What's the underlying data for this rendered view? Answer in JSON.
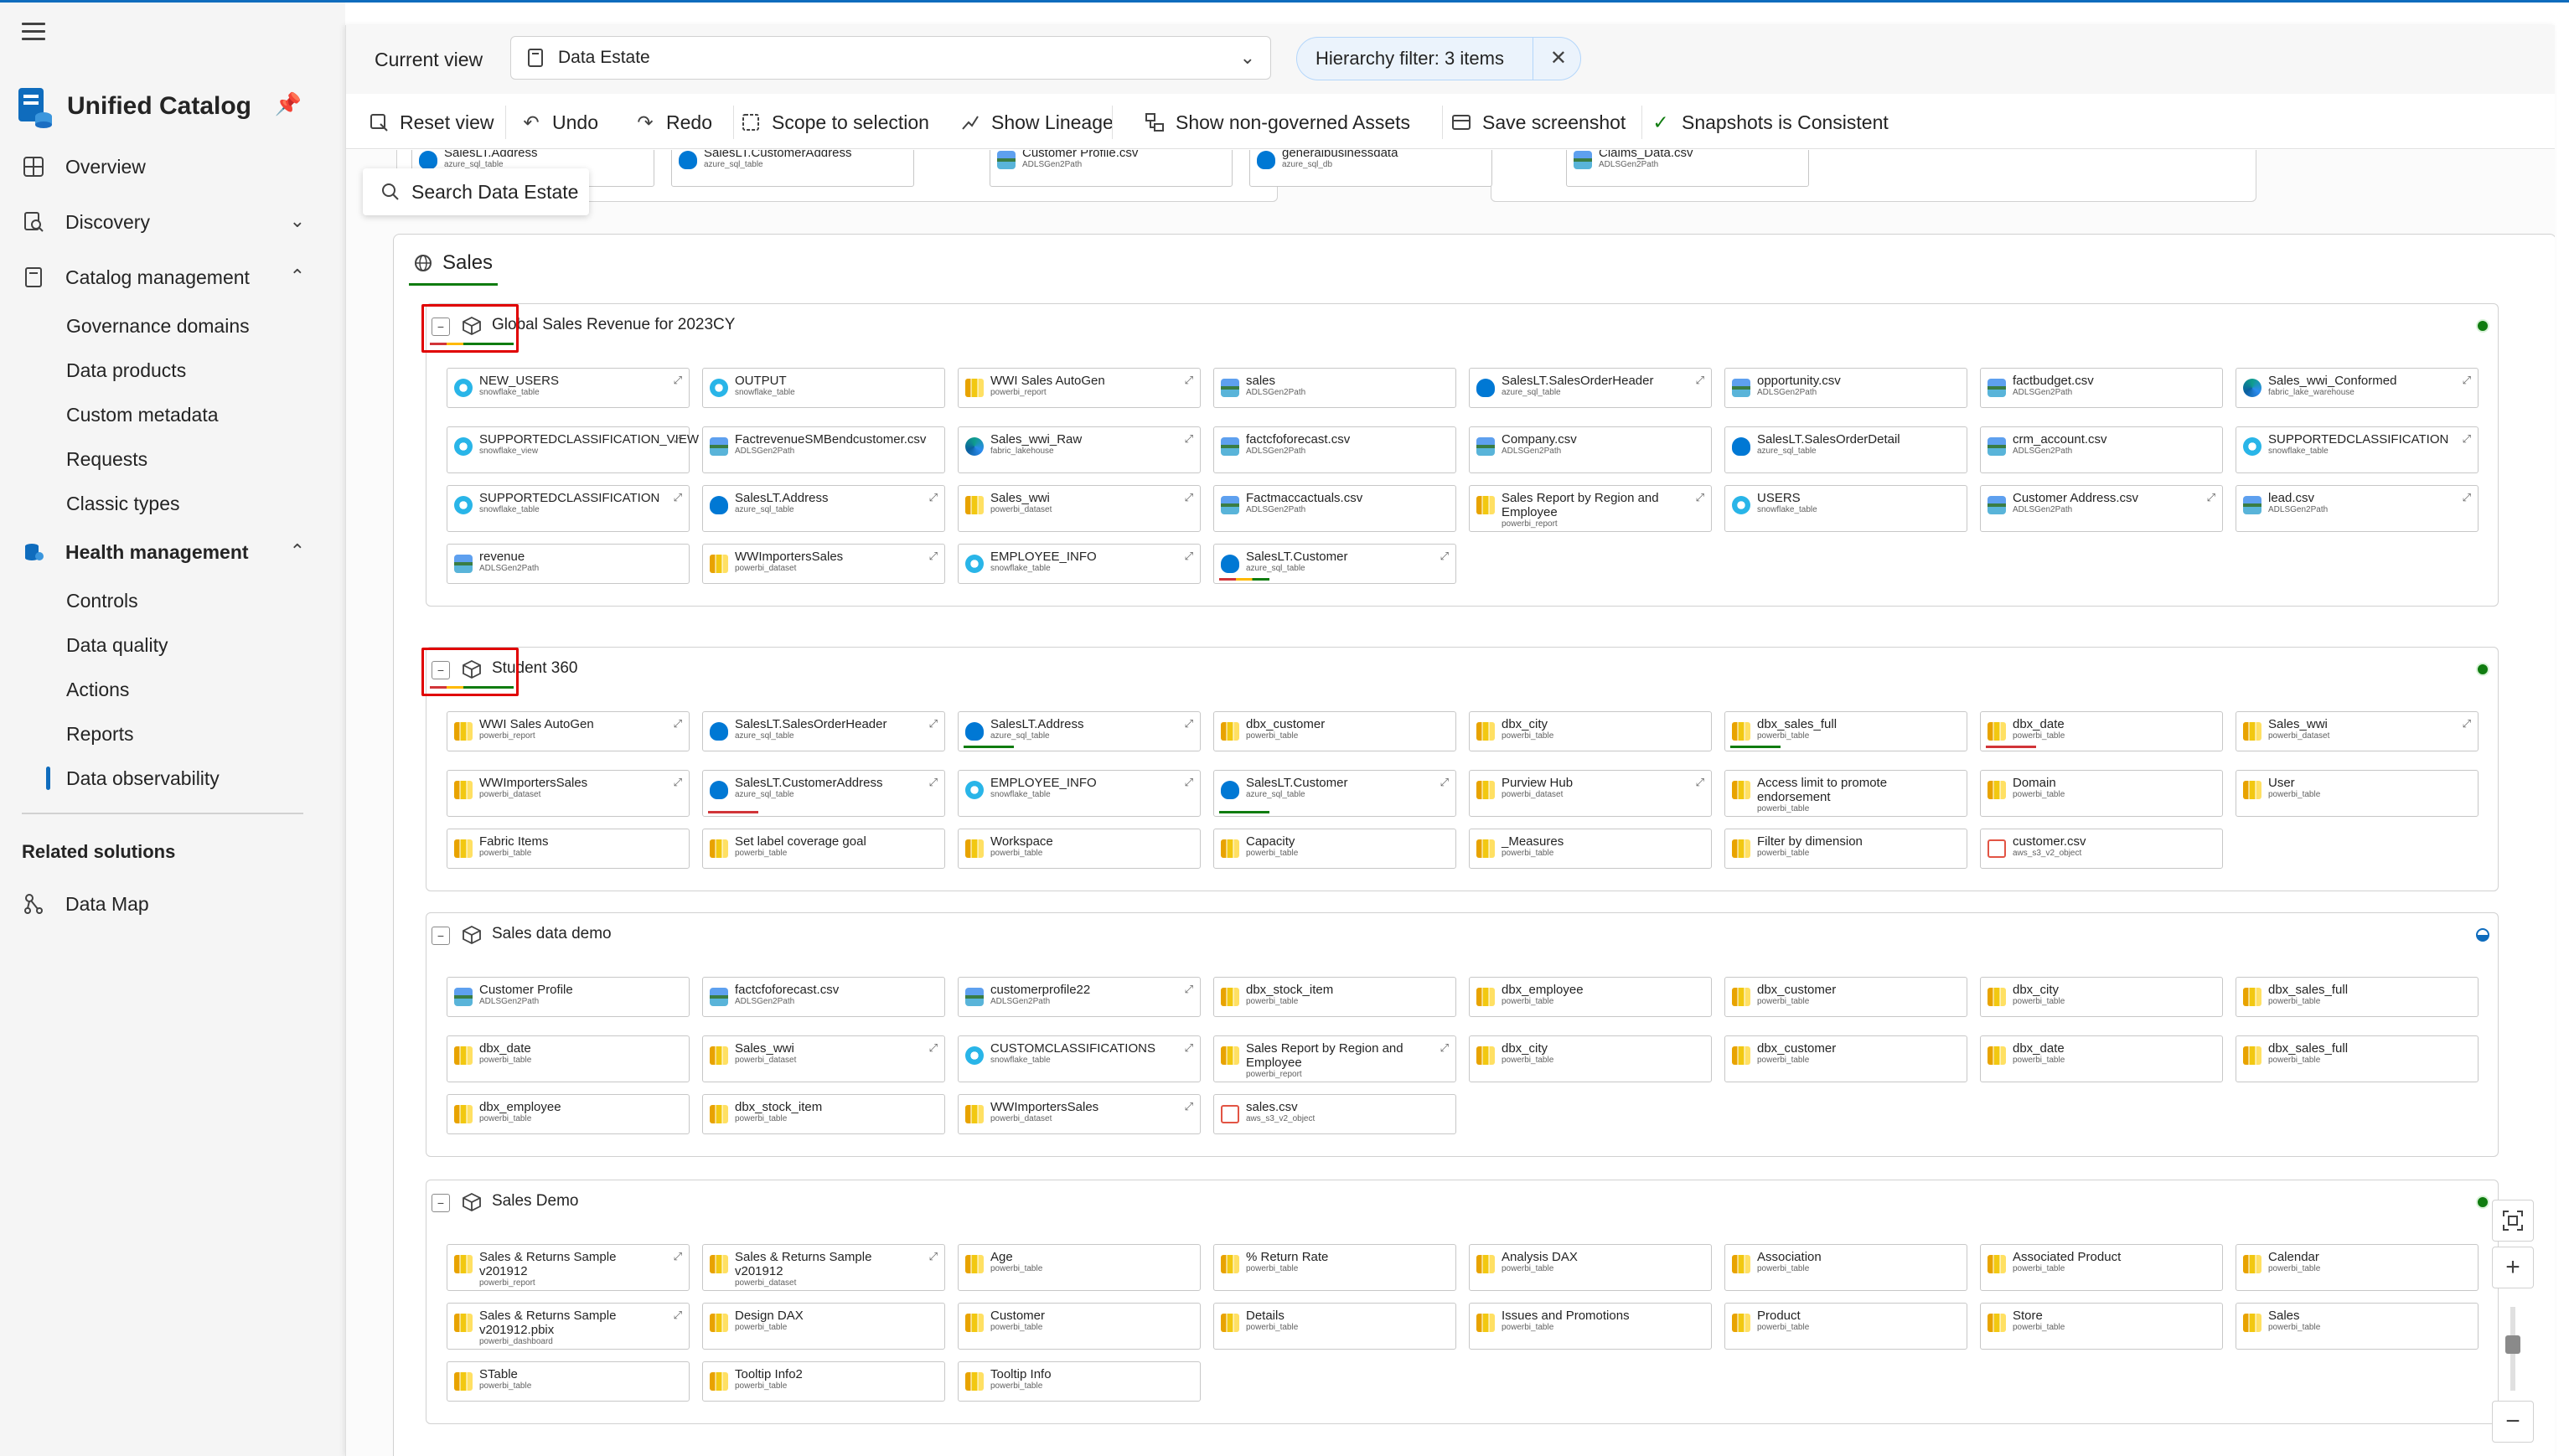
{
  "app": {
    "title": "Unified Catalog",
    "colors": {
      "accent": "#0f6cbd",
      "healthy": "#107c10",
      "warning": "#ffb900",
      "critical": "#d13438",
      "highlight_box": "#e00000"
    }
  },
  "sidebar": {
    "nav": [
      {
        "label": "Overview",
        "icon": "overview-icon"
      },
      {
        "label": "Discovery",
        "icon": "discovery-icon",
        "expanded": false
      },
      {
        "label": "Catalog management",
        "icon": "catalog-icon",
        "expanded": true,
        "children": [
          "Governance domains",
          "Data products",
          "Custom metadata",
          "Requests",
          "Classic types"
        ]
      },
      {
        "label": "Health management",
        "icon": "health-icon",
        "expanded": true,
        "children": [
          "Controls",
          "Data quality",
          "Actions",
          "Reports",
          "Data observability"
        ]
      }
    ],
    "active_item": "Data observability",
    "related_title": "Related solutions",
    "related": [
      {
        "label": "Data Map",
        "icon": "data-map-icon"
      }
    ]
  },
  "viewbar": {
    "current_view_label": "Current view",
    "current_view_value": "Data Estate",
    "hierarchy_filter": "Hierarchy filter: 3 items"
  },
  "toolbar": {
    "reset_view": "Reset view",
    "undo": "Undo",
    "redo": "Redo",
    "scope": "Scope to selection",
    "lineage": "Show Lineage",
    "non_governed": "Show non-governed Assets",
    "screenshot": "Save screenshot",
    "snapshots": "Snapshots is Consistent"
  },
  "search": {
    "label": "Search Data Estate"
  },
  "previous_row": [
    {
      "name": "SalesLT.Address",
      "type": "azure_sql_table",
      "icon": "sql"
    },
    {
      "name": "SalesLT.CustomerAddress",
      "type": "azure_sql_table",
      "icon": "sql"
    },
    {
      "name": "Customer Profile.csv",
      "type": "ADLSGen2Path",
      "icon": "adls"
    },
    {
      "name": "generalbusinessdata",
      "type": "azure_sql_db",
      "icon": "sql"
    },
    {
      "name": "Claims_Data.csv",
      "type": "ADLSGen2Path",
      "icon": "adls"
    }
  ],
  "domain": {
    "name": "Sales",
    "data_products": [
      {
        "name": "Global Sales Revenue for 2023CY",
        "status": "healthy",
        "highlighted": true,
        "assets": [
          {
            "name": "NEW_USERS",
            "type": "snowflake_table",
            "icon": "snow",
            "link": true
          },
          {
            "name": "OUTPUT",
            "type": "snowflake_table",
            "icon": "snow"
          },
          {
            "name": "WWI Sales AutoGen",
            "type": "powerbi_report",
            "icon": "pbi",
            "link": true
          },
          {
            "name": "sales",
            "type": "ADLSGen2Path",
            "icon": "adls"
          },
          {
            "name": "SalesLT.SalesOrderHeader",
            "type": "azure_sql_table",
            "icon": "sql",
            "link": true
          },
          {
            "name": "opportunity.csv",
            "type": "ADLSGen2Path",
            "icon": "adls"
          },
          {
            "name": "factbudget.csv",
            "type": "ADLSGen2Path",
            "icon": "adls"
          },
          {
            "name": "Sales_wwi_Conformed",
            "type": "fabric_lake_warehouse",
            "icon": "fabric",
            "link": true
          },
          {
            "name": "SUPPORTEDCLASSIFICATION_VIEW",
            "type": "snowflake_view",
            "icon": "snow",
            "link": true
          },
          {
            "name": "FactrevenueSMBendcustomer.csv",
            "type": "ADLSGen2Path",
            "icon": "adls"
          },
          {
            "name": "Sales_wwi_Raw",
            "type": "fabric_lakehouse",
            "icon": "fabric",
            "link": true
          },
          {
            "name": "factcfoforecast.csv",
            "type": "ADLSGen2Path",
            "icon": "adls"
          },
          {
            "name": "Company.csv",
            "type": "ADLSGen2Path",
            "icon": "adls"
          },
          {
            "name": "SalesLT.SalesOrderDetail",
            "type": "azure_sql_table",
            "icon": "sql"
          },
          {
            "name": "crm_account.csv",
            "type": "ADLSGen2Path",
            "icon": "adls"
          },
          {
            "name": "SUPPORTEDCLASSIFICATION",
            "type": "snowflake_table",
            "icon": "snow",
            "link": true
          },
          {
            "name": "SUPPORTEDCLASSIFICATION",
            "type": "snowflake_table",
            "icon": "snow",
            "link": true
          },
          {
            "name": "SalesLT.Address",
            "type": "azure_sql_table",
            "icon": "sql",
            "link": true
          },
          {
            "name": "Sales_wwi",
            "type": "powerbi_dataset",
            "icon": "pbi",
            "link": true
          },
          {
            "name": "Factmaccactuals.csv",
            "type": "ADLSGen2Path",
            "icon": "adls"
          },
          {
            "name": "Sales Report by Region and Employee",
            "type": "powerbi_report",
            "icon": "pbi",
            "link": true
          },
          {
            "name": "USERS",
            "type": "snowflake_table",
            "icon": "snow"
          },
          {
            "name": "Customer Address.csv",
            "type": "ADLSGen2Path",
            "icon": "adls",
            "link": true
          },
          {
            "name": "lead.csv",
            "type": "ADLSGen2Path",
            "icon": "adls",
            "link": true
          },
          {
            "name": "revenue",
            "type": "ADLSGen2Path",
            "icon": "adls"
          },
          {
            "name": "WWImportersSales",
            "type": "powerbi_dataset",
            "icon": "pbi",
            "link": true
          },
          {
            "name": "EMPLOYEE_INFO",
            "type": "snowflake_table",
            "icon": "snow",
            "link": true
          },
          {
            "name": "SalesLT.Customer",
            "type": "azure_sql_table",
            "icon": "sql",
            "link": true,
            "bar": "mixed"
          }
        ]
      },
      {
        "name": "Student 360",
        "status": "healthy",
        "highlighted": true,
        "assets": [
          {
            "name": "WWI Sales AutoGen",
            "type": "powerbi_report",
            "icon": "pbi",
            "link": true
          },
          {
            "name": "SalesLT.SalesOrderHeader",
            "type": "azure_sql_table",
            "icon": "sql",
            "link": true
          },
          {
            "name": "SalesLT.Address",
            "type": "azure_sql_table",
            "icon": "sql",
            "link": true,
            "bar": "green"
          },
          {
            "name": "dbx_customer",
            "type": "powerbi_table",
            "icon": "pbi"
          },
          {
            "name": "dbx_city",
            "type": "powerbi_table",
            "icon": "pbi"
          },
          {
            "name": "dbx_sales_full",
            "type": "powerbi_table",
            "icon": "pbi",
            "bar": "green"
          },
          {
            "name": "dbx_date",
            "type": "powerbi_table",
            "icon": "pbi",
            "bar": "red"
          },
          {
            "name": "Sales_wwi",
            "type": "powerbi_dataset",
            "icon": "pbi",
            "link": true
          },
          {
            "name": "WWImportersSales",
            "type": "powerbi_dataset",
            "icon": "pbi",
            "link": true
          },
          {
            "name": "SalesLT.CustomerAddress",
            "type": "azure_sql_table",
            "icon": "sql",
            "link": true,
            "bar": "red"
          },
          {
            "name": "EMPLOYEE_INFO",
            "type": "snowflake_table",
            "icon": "snow",
            "link": true
          },
          {
            "name": "SalesLT.Customer",
            "type": "azure_sql_table",
            "icon": "sql",
            "link": true,
            "bar": "green"
          },
          {
            "name": "Purview Hub",
            "type": "powerbi_dataset",
            "icon": "pbi",
            "link": true
          },
          {
            "name": "Access limit to promote endorsement",
            "type": "powerbi_table",
            "icon": "pbi"
          },
          {
            "name": "Domain",
            "type": "powerbi_table",
            "icon": "pbi"
          },
          {
            "name": "User",
            "type": "powerbi_table",
            "icon": "pbi"
          },
          {
            "name": "Fabric Items",
            "type": "powerbi_table",
            "icon": "pbi"
          },
          {
            "name": "Set label coverage goal",
            "type": "powerbi_table",
            "icon": "pbi"
          },
          {
            "name": "Workspace",
            "type": "powerbi_table",
            "icon": "pbi"
          },
          {
            "name": "Capacity",
            "type": "powerbi_table",
            "icon": "pbi"
          },
          {
            "name": "_Measures",
            "type": "powerbi_table",
            "icon": "pbi"
          },
          {
            "name": "Filter by dimension",
            "type": "powerbi_table",
            "icon": "pbi"
          },
          {
            "name": "customer.csv",
            "type": "aws_s3_v2_object",
            "icon": "s3"
          }
        ]
      },
      {
        "name": "Sales data demo",
        "status": "partial",
        "highlighted": false,
        "assets": [
          {
            "name": "Customer Profile",
            "type": "ADLSGen2Path",
            "icon": "adls"
          },
          {
            "name": "factcfoforecast.csv",
            "type": "ADLSGen2Path",
            "icon": "adls"
          },
          {
            "name": "customerprofile22",
            "type": "ADLSGen2Path",
            "icon": "adls",
            "link": true
          },
          {
            "name": "dbx_stock_item",
            "type": "powerbi_table",
            "icon": "pbi"
          },
          {
            "name": "dbx_employee",
            "type": "powerbi_table",
            "icon": "pbi"
          },
          {
            "name": "dbx_customer",
            "type": "powerbi_table",
            "icon": "pbi"
          },
          {
            "name": "dbx_city",
            "type": "powerbi_table",
            "icon": "pbi"
          },
          {
            "name": "dbx_sales_full",
            "type": "powerbi_table",
            "icon": "pbi"
          },
          {
            "name": "dbx_date",
            "type": "powerbi_table",
            "icon": "pbi"
          },
          {
            "name": "Sales_wwi",
            "type": "powerbi_dataset",
            "icon": "pbi",
            "link": true
          },
          {
            "name": "CUSTOMCLASSIFICATIONS",
            "type": "snowflake_table",
            "icon": "snow",
            "link": true
          },
          {
            "name": "Sales Report by Region and Employee",
            "type": "powerbi_report",
            "icon": "pbi",
            "link": true
          },
          {
            "name": "dbx_city",
            "type": "powerbi_table",
            "icon": "pbi"
          },
          {
            "name": "dbx_customer",
            "type": "powerbi_table",
            "icon": "pbi"
          },
          {
            "name": "dbx_date",
            "type": "powerbi_table",
            "icon": "pbi"
          },
          {
            "name": "dbx_sales_full",
            "type": "powerbi_table",
            "icon": "pbi"
          },
          {
            "name": "dbx_employee",
            "type": "powerbi_table",
            "icon": "pbi"
          },
          {
            "name": "dbx_stock_item",
            "type": "powerbi_table",
            "icon": "pbi"
          },
          {
            "name": "WWImportersSales",
            "type": "powerbi_dataset",
            "icon": "pbi",
            "link": true
          },
          {
            "name": "sales.csv",
            "type": "aws_s3_v2_object",
            "icon": "s3"
          }
        ]
      },
      {
        "name": "Sales Demo",
        "status": "healthy",
        "highlighted": false,
        "assets": [
          {
            "name": "Sales & Returns Sample v201912",
            "type": "powerbi_report",
            "icon": "pbi",
            "link": true
          },
          {
            "name": "Sales & Returns Sample v201912",
            "type": "powerbi_dataset",
            "icon": "pbi",
            "link": true
          },
          {
            "name": "Age",
            "type": "powerbi_table",
            "icon": "pbi"
          },
          {
            "name": "% Return Rate",
            "type": "powerbi_table",
            "icon": "pbi"
          },
          {
            "name": "Analysis DAX",
            "type": "powerbi_table",
            "icon": "pbi"
          },
          {
            "name": "Association",
            "type": "powerbi_table",
            "icon": "pbi"
          },
          {
            "name": "Associated Product",
            "type": "powerbi_table",
            "icon": "pbi"
          },
          {
            "name": "Calendar",
            "type": "powerbi_table",
            "icon": "pbi"
          },
          {
            "name": "Sales & Returns Sample v201912.pbix",
            "type": "powerbi_dashboard",
            "icon": "pbi",
            "link": true
          },
          {
            "name": "Design DAX",
            "type": "powerbi_table",
            "icon": "pbi"
          },
          {
            "name": "Customer",
            "type": "powerbi_table",
            "icon": "pbi"
          },
          {
            "name": "Details",
            "type": "powerbi_table",
            "icon": "pbi"
          },
          {
            "name": "Issues and Promotions",
            "type": "powerbi_table",
            "icon": "pbi"
          },
          {
            "name": "Product",
            "type": "powerbi_table",
            "icon": "pbi"
          },
          {
            "name": "Store",
            "type": "powerbi_table",
            "icon": "pbi"
          },
          {
            "name": "Sales",
            "type": "powerbi_table",
            "icon": "pbi"
          },
          {
            "name": "STable",
            "type": "powerbi_table",
            "icon": "pbi"
          },
          {
            "name": "Tooltip Info2",
            "type": "powerbi_table",
            "icon": "pbi"
          },
          {
            "name": "Tooltip Info",
            "type": "powerbi_table",
            "icon": "pbi"
          }
        ]
      }
    ]
  }
}
